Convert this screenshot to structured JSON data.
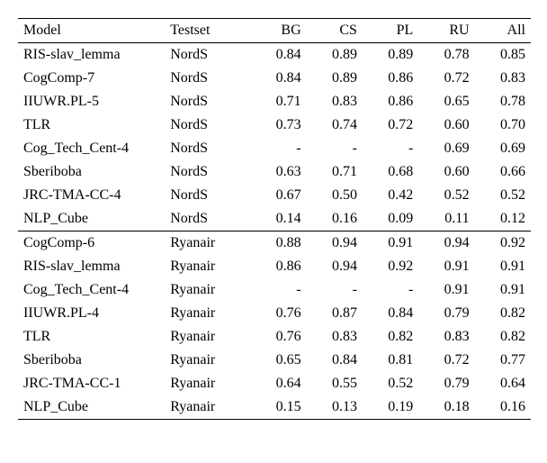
{
  "chart_data": {
    "type": "table",
    "columns": [
      "Model",
      "Testset",
      "BG",
      "CS",
      "PL",
      "RU",
      "All"
    ],
    "sections": [
      {
        "rows": [
          {
            "model": "RIS-slav_lemma",
            "testset": "NordS",
            "bg": "0.84",
            "cs": "0.89",
            "pl": "0.89",
            "ru": "0.78",
            "all": "0.85"
          },
          {
            "model": "CogComp-7",
            "testset": "NordS",
            "bg": "0.84",
            "cs": "0.89",
            "pl": "0.86",
            "ru": "0.72",
            "all": "0.83"
          },
          {
            "model": "IIUWR.PL-5",
            "testset": "NordS",
            "bg": "0.71",
            "cs": "0.83",
            "pl": "0.86",
            "ru": "0.65",
            "all": "0.78"
          },
          {
            "model": "TLR",
            "testset": "NordS",
            "bg": "0.73",
            "cs": "0.74",
            "pl": "0.72",
            "ru": "0.60",
            "all": "0.70"
          },
          {
            "model": "Cog_Tech_Cent-4",
            "testset": "NordS",
            "bg": "-",
            "cs": "-",
            "pl": "-",
            "ru": "0.69",
            "all": "0.69"
          },
          {
            "model": "Sberiboba",
            "testset": "NordS",
            "bg": "0.63",
            "cs": "0.71",
            "pl": "0.68",
            "ru": "0.60",
            "all": "0.66"
          },
          {
            "model": "JRC-TMA-CC-4",
            "testset": "NordS",
            "bg": "0.67",
            "cs": "0.50",
            "pl": "0.42",
            "ru": "0.52",
            "all": "0.52"
          },
          {
            "model": "NLP_Cube",
            "testset": "NordS",
            "bg": "0.14",
            "cs": "0.16",
            "pl": "0.09",
            "ru": "0.11",
            "all": "0.12"
          }
        ]
      },
      {
        "rows": [
          {
            "model": "CogComp-6",
            "testset": "Ryanair",
            "bg": "0.88",
            "cs": "0.94",
            "pl": "0.91",
            "ru": "0.94",
            "all": "0.92"
          },
          {
            "model": "RIS-slav_lemma",
            "testset": "Ryanair",
            "bg": "0.86",
            "cs": "0.94",
            "pl": "0.92",
            "ru": "0.91",
            "all": "0.91"
          },
          {
            "model": "Cog_Tech_Cent-4",
            "testset": "Ryanair",
            "bg": "-",
            "cs": "-",
            "pl": "-",
            "ru": "0.91",
            "all": "0.91"
          },
          {
            "model": "IIUWR.PL-4",
            "testset": "Ryanair",
            "bg": "0.76",
            "cs": "0.87",
            "pl": "0.84",
            "ru": "0.79",
            "all": "0.82"
          },
          {
            "model": "TLR",
            "testset": "Ryanair",
            "bg": "0.76",
            "cs": "0.83",
            "pl": "0.82",
            "ru": "0.83",
            "all": "0.82"
          },
          {
            "model": "Sberiboba",
            "testset": "Ryanair",
            "bg": "0.65",
            "cs": "0.84",
            "pl": "0.81",
            "ru": "0.72",
            "all": "0.77"
          },
          {
            "model": "JRC-TMA-CC-1",
            "testset": "Ryanair",
            "bg": "0.64",
            "cs": "0.55",
            "pl": "0.52",
            "ru": "0.79",
            "all": "0.64"
          },
          {
            "model": "NLP_Cube",
            "testset": "Ryanair",
            "bg": "0.15",
            "cs": "0.13",
            "pl": "0.19",
            "ru": "0.18",
            "all": "0.16"
          }
        ]
      }
    ]
  }
}
